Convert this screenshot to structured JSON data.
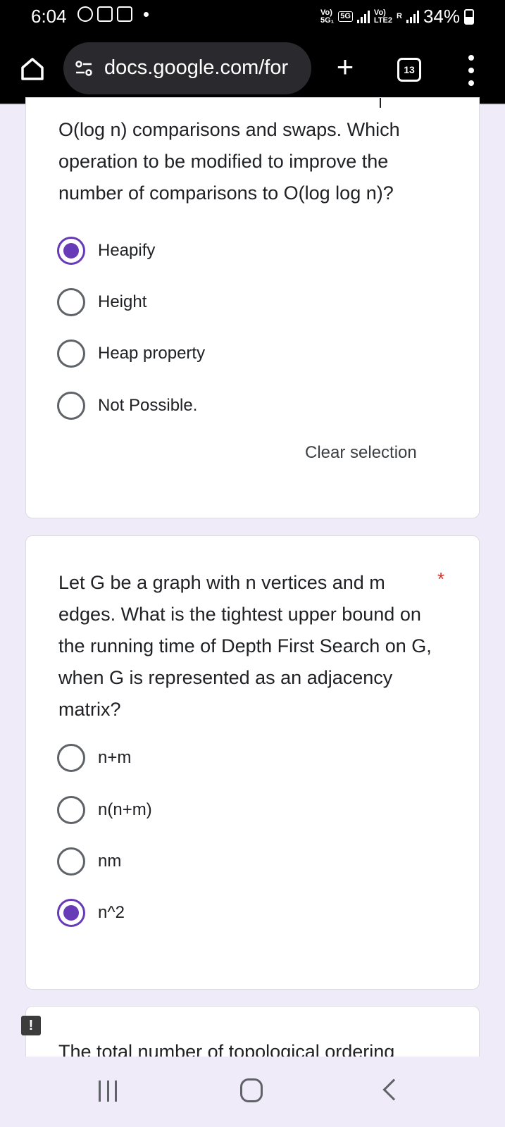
{
  "status_bar": {
    "time": "6:04",
    "net1_top": "Vo)",
    "net1_bottom": "5G₁",
    "net_type": "5G",
    "net2_top": "Vo)",
    "net2_bottom": "LTE2",
    "roaming": "R",
    "battery": "34%"
  },
  "browser": {
    "url": "docs.google.com/for",
    "tab_count": "13"
  },
  "question1": {
    "text": "O(log n) comparisons and swaps. Which operation to be modified to improve the number of comparisons to O(log log n)?",
    "options": [
      {
        "label": "Heapify",
        "selected": true
      },
      {
        "label": "Height",
        "selected": false
      },
      {
        "label": "Heap property",
        "selected": false
      },
      {
        "label": "Not Possible.",
        "selected": false
      }
    ],
    "clear_selection": "Clear selection"
  },
  "question2": {
    "text": "Let G be a graph with n vertices and m edges. What is the tightest upper bound on the running time of Depth First Search on G, when G is represented as an adjacency matrix?",
    "required_mark": "*",
    "options": [
      {
        "label": "n+m",
        "selected": false
      },
      {
        "label": "n(n+m)",
        "selected": false
      },
      {
        "label": "nm",
        "selected": false
      },
      {
        "label": "n^2",
        "selected": true
      }
    ]
  },
  "question3": {
    "text": "The total number of topological ordering"
  },
  "feedback_badge": "!",
  "colors": {
    "accent": "#673ab7",
    "background": "#f0ebf8",
    "required": "#d93025"
  },
  "icons": [
    "home-icon",
    "site-info-icon",
    "plus-icon",
    "tab-switcher-icon",
    "more-menu-icon",
    "recents-icon",
    "home-nav-icon",
    "back-icon"
  ]
}
